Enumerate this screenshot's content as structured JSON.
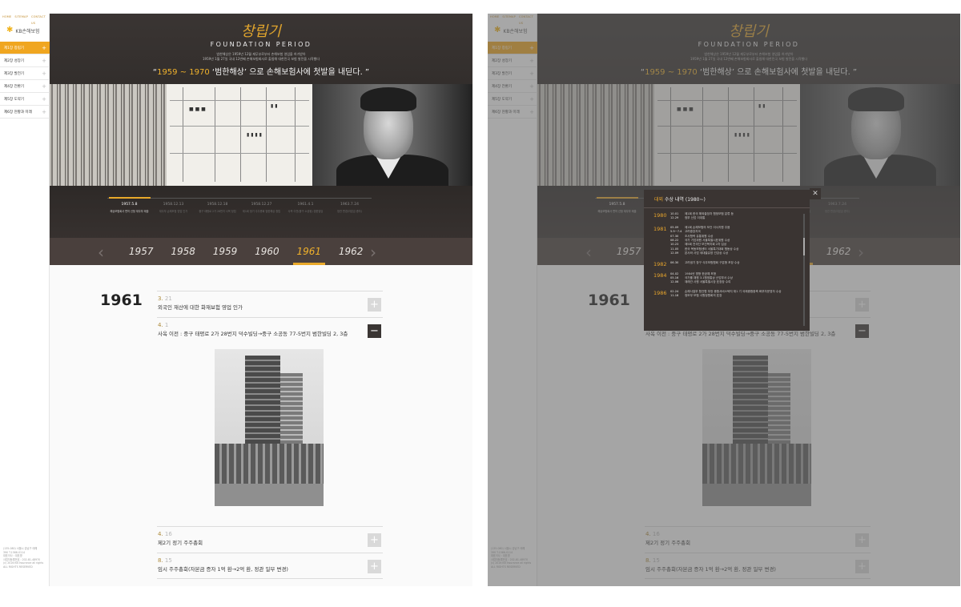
{
  "topnav": [
    "HOME",
    "SITEMAP",
    "CONTACT US"
  ],
  "logo": "KB손해보험",
  "sidebar": [
    {
      "label": "제1장 창립기",
      "active": true
    },
    {
      "label": "제2장 성장기",
      "active": false
    },
    {
      "label": "제3장 발전기",
      "active": false
    },
    {
      "label": "제4장 전환기",
      "active": false
    },
    {
      "label": "제5장 도약기",
      "active": false
    },
    {
      "label": "제6장 현황과 미래",
      "active": false
    }
  ],
  "footer": [
    "(135-080) 서울시 강남구 테헤",
    "390 T.1566-0114",
    "대표이사 : 대표명",
    "사업자등록번호 : 202-81-48970",
    "(c) 2016 KB Insurance all rights",
    "ALL RIGHTS RESERVED"
  ],
  "hero": {
    "title": "창립기",
    "subtitle": "FOUNDATION PERIOD",
    "desc1": "범한해상은 1959년 12월 재무부로부터 손해보험 영업을 허가받아",
    "desc2": "1959년 1월 27일 국내 12번째 손해보험회사로 출범해 대한민국 보험 발전을 시작했다",
    "quote_pre": "“",
    "quote_hl": "1959 ~ 1970",
    "quote_post": " ‘범한해상’ 으로 손해보험사에 첫발을 내딛다. ”"
  },
  "timeline": [
    {
      "date": "1957.5.8",
      "text": "해상보험회사 면허 신청 재무부 제출",
      "active": true
    },
    {
      "date": "1958.12.13",
      "text": "재무부 손해보험 영업 인가",
      "active": false
    },
    {
      "date": "1958.12.18",
      "text": "중구 태평로 2가 28번지 사옥 정립",
      "active": false
    },
    {
      "date": "1958.12.27",
      "text": "제1회 정기 주주총회 범한해상 창립",
      "active": false
    },
    {
      "date": "1961.4.1",
      "text": "사옥 이전(중구 소공동) 범한빌딩",
      "active": false
    },
    {
      "date": "1963.7.24",
      "text": "정관 변경(자본금 증자)",
      "active": false
    }
  ],
  "years": [
    {
      "label": "1957",
      "active": false
    },
    {
      "label": "1958",
      "active": false
    },
    {
      "label": "1959",
      "active": false
    },
    {
      "label": "1960",
      "active": false
    },
    {
      "label": "1961",
      "active": true
    },
    {
      "label": "1962",
      "active": false
    }
  ],
  "content": {
    "year": "1961",
    "entries": [
      {
        "month": "3.",
        "day": " 21",
        "text": "외국인 재산에 대한 화재보험 영업 인가",
        "btn": "+",
        "expanded": false
      },
      {
        "month": "4.",
        "day": " 1",
        "text": "사옥 이전 : 중구 태평로 2가 28번지 덕수빌딩→중구 소공동 77-5번지 범한빌딩 2, 3층",
        "btn": "−",
        "expanded": true
      },
      {
        "month": "4.",
        "day": " 16",
        "text": "제2기 정기 주주총회",
        "btn": "+",
        "expanded": false
      },
      {
        "month": "8.",
        "day": " 15",
        "text": "임시 주주총회(자본금 증자 1억 환→2억 환, 정관 일부 변경)",
        "btn": "+",
        "expanded": false
      }
    ]
  },
  "popup": {
    "title_hl": "대외",
    "title_rest": " 수상 내역 (1980~)",
    "close": "✕",
    "groups": [
      {
        "year": "1980",
        "rows": [
          [
            "10.01",
            "제1회 한국 해외출장자 협정보험 분류 등"
          ],
          [
            "12.29",
            "정부 산업 이대통"
          ]
        ]
      },
      {
        "year": "1981",
        "rows": [
          [
            "05.09",
            "제1회 손해보험의 보건 이사지원 주음"
          ],
          [
            "5.9~7.4",
            "고려중앙지국"
          ],
          [
            "07.30",
            "조사협력 유통위원 수상"
          ],
          [
            "08.22",
            "국가 기업위원 서울특별시표위원 수상"
          ],
          [
            "10.23",
            "제5회 전국단 보건복지회 2차 입상"
          ],
          [
            "11.05",
            "한국 목동보험센터 서울특기대회 협동상 수상"
          ],
          [
            "12.09",
            "본사와 사업 세대출유양 건강상 수상"
          ]
        ]
      },
      {
        "year": "1982",
        "rows": [
          [
            "06.30",
            "고려생기 창구 식무보험협회 구분형 포장 수상"
          ]
        ]
      },
      {
        "year": "1984",
        "rows": [
          [
            "04.02",
            "1984년 명형 한공예 포형"
          ],
          [
            "05.16",
            "국가를 채원 3.1협정통상 산업부서 수상"
          ],
          [
            "12.06",
            "재래관 사원 서울특별시장 표창장 수여"
          ]
        ]
      },
      {
        "year": "1986",
        "rows": [
          [
            "02.24",
            "손해사절부 협건협 부장 종합서비스텍지 재1 기 국제종합중축 화부자운영자 수상"
          ],
          [
            "11.18",
            "정보부 보험 사원정원회의 표장"
          ]
        ]
      }
    ]
  }
}
